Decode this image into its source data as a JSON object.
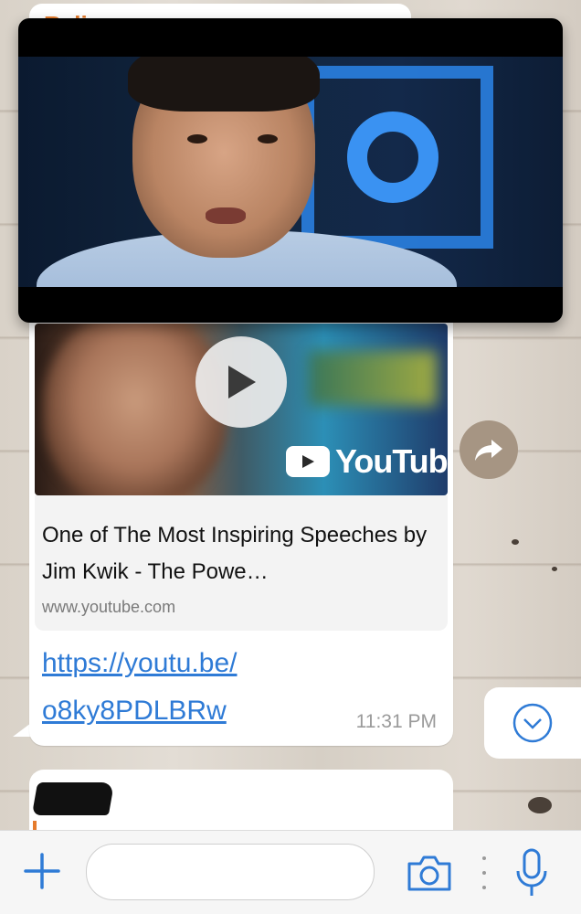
{
  "top_bubble": {
    "sender": "Rali"
  },
  "video_player": {
    "state": "playing"
  },
  "message": {
    "preview_title": "One of The Most Inspiring Speeches by Jim Kwik - The Powe…",
    "preview_domain": "www.youtube.com",
    "thumbnail_brand": "YouTube",
    "url_line1": "https://youtu.be/",
    "url_line2": "o8ky8PDLBRw",
    "time": "11:31 PM"
  },
  "icons": {
    "play": "play-icon",
    "share": "forward-share-icon",
    "scroll_down": "chevron-down-circle-icon",
    "attach": "plus-icon",
    "camera": "camera-icon",
    "mic": "microphone-icon"
  },
  "input": {
    "placeholder": ""
  },
  "colors": {
    "accent": "#2f7bd6",
    "sender": "#e57b2c",
    "share_bg": "#a69583"
  }
}
